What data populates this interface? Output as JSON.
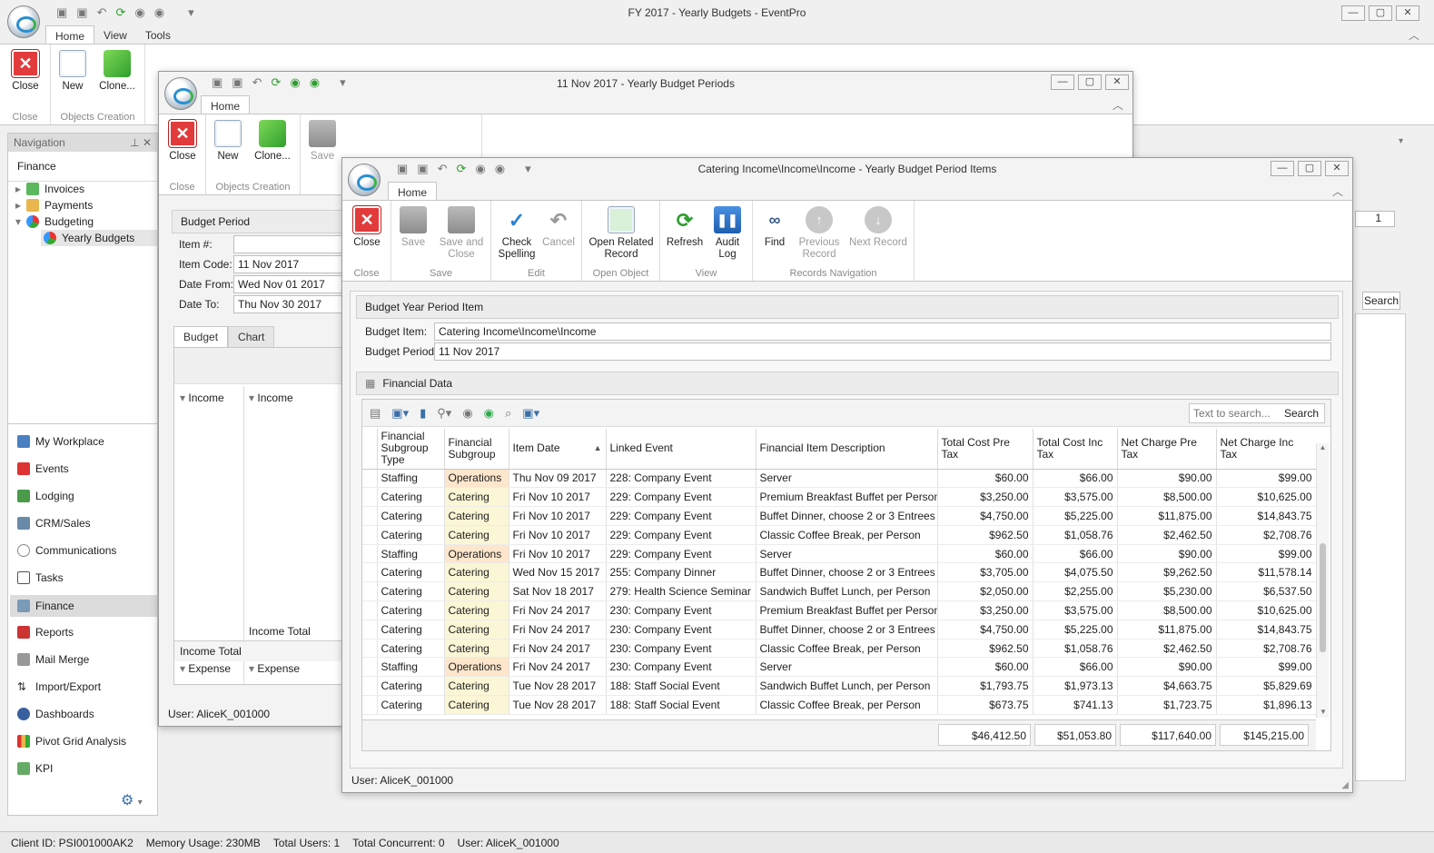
{
  "main": {
    "title": "FY 2017 - Yearly Budgets - EventPro",
    "tabs": [
      "Home",
      "View",
      "Tools"
    ],
    "close_label": "Close",
    "new_label": "New",
    "clone_label": "Clone...",
    "group_close": "Close",
    "group_objects": "Objects Creation",
    "search_label": "Search",
    "spin_value": "1"
  },
  "navigation": {
    "header": "Navigation",
    "section": "Finance",
    "tree": [
      "Invoices",
      "Payments",
      "Budgeting",
      "Yearly Budgets"
    ],
    "modules": [
      "My Workplace",
      "Events",
      "Lodging",
      "CRM/Sales",
      "Communications",
      "Tasks",
      "Finance",
      "Reports",
      "Mail Merge",
      "Import/Export",
      "Dashboards",
      "Pivot Grid Analysis",
      "KPI"
    ]
  },
  "status": {
    "client": "Client ID: PSI001000AK2",
    "memory": "Memory Usage: 230MB",
    "users": "Total Users: 1",
    "concurrent": "Total Concurrent: 0",
    "user": "User: AliceK_001000"
  },
  "periods": {
    "title": "11 Nov 2017 - Yearly Budget Periods",
    "tab": "Home",
    "buttons": {
      "close": "Close",
      "new": "New",
      "clone": "Clone...",
      "save": "Save"
    },
    "groups": {
      "close": "Close",
      "objects": "Objects Creation"
    },
    "panel_title": "Budget Period",
    "labels": {
      "item_no": "Item #:",
      "item_code": "Item Code:",
      "date_from": "Date From:",
      "date_to": "Date To:"
    },
    "values": {
      "item_no": "",
      "item_code": "11 Nov 2017",
      "date_from": "Wed Nov 01 2017",
      "date_to": "Thu Nov 30 2017"
    },
    "tabs": [
      "Budget",
      "Chart"
    ],
    "tree": {
      "income1": "Income",
      "income2": "Income",
      "income_total_inner": "Income Total",
      "income_total": "Income Total",
      "expense1": "Expense",
      "expense2": "Expense"
    },
    "user": "User: AliceK_001000"
  },
  "items": {
    "title": "Catering Income\\Income\\Income - Yearly Budget Period Items",
    "tab": "Home",
    "buttons": {
      "close": "Close",
      "save": "Save",
      "save_close": "Save and Close",
      "check": "Check Spelling",
      "cancel": "Cancel",
      "open_related": "Open Related Record",
      "refresh": "Refresh",
      "audit": "Audit Log",
      "find": "Find",
      "previous": "Previous Record",
      "next": "Next Record"
    },
    "groups": {
      "close": "Close",
      "save": "Save",
      "edit": "Edit",
      "open": "Open Object",
      "view": "View",
      "nav": "Records Navigation"
    },
    "panel_title": "Budget Year Period Item",
    "budget_item_label": "Budget Item:",
    "budget_item": "Catering Income\\Income\\Income",
    "budget_period_label": "Budget Period:",
    "budget_period": "11 Nov 2017",
    "financial_title": "Financial Data",
    "search_placeholder": "Text to search...",
    "search_button": "Search",
    "columns": [
      "Financial Subgroup Type",
      "Financial Subgroup",
      "Item Date",
      "Linked Event",
      "Financial Item Description",
      "Total Cost Pre Tax",
      "Total Cost Inc Tax",
      "Net Charge Pre Tax",
      "Net Charge Inc Tax"
    ],
    "rows": [
      [
        "Staffing",
        "Operations",
        "Thu Nov 09 2017",
        "228: Company Event",
        "Server",
        "$60.00",
        "$66.00",
        "$90.00",
        "$99.00"
      ],
      [
        "Catering",
        "Catering",
        "Fri Nov 10 2017",
        "229: Company Event",
        "Premium Breakfast Buffet per Person",
        "$3,250.00",
        "$3,575.00",
        "$8,500.00",
        "$10,625.00"
      ],
      [
        "Catering",
        "Catering",
        "Fri Nov 10 2017",
        "229: Company Event",
        "Buffet Dinner, choose 2 or 3 Entrees",
        "$4,750.00",
        "$5,225.00",
        "$11,875.00",
        "$14,843.75"
      ],
      [
        "Catering",
        "Catering",
        "Fri Nov 10 2017",
        "229: Company Event",
        "Classic Coffee Break, per Person",
        "$962.50",
        "$1,058.76",
        "$2,462.50",
        "$2,708.76"
      ],
      [
        "Staffing",
        "Operations",
        "Fri Nov 10 2017",
        "229: Company Event",
        "Server",
        "$60.00",
        "$66.00",
        "$90.00",
        "$99.00"
      ],
      [
        "Catering",
        "Catering",
        "Wed Nov 15 2017",
        "255: Company Dinner",
        "Buffet Dinner, choose 2 or 3 Entrees",
        "$3,705.00",
        "$4,075.50",
        "$9,262.50",
        "$11,578.14"
      ],
      [
        "Catering",
        "Catering",
        "Sat Nov 18 2017",
        "279: Health Science Seminar",
        "Sandwich Buffet Lunch, per Person",
        "$2,050.00",
        "$2,255.00",
        "$5,230.00",
        "$6,537.50"
      ],
      [
        "Catering",
        "Catering",
        "Fri Nov 24 2017",
        "230: Company Event",
        "Premium Breakfast Buffet per Person",
        "$3,250.00",
        "$3,575.00",
        "$8,500.00",
        "$10,625.00"
      ],
      [
        "Catering",
        "Catering",
        "Fri Nov 24 2017",
        "230: Company Event",
        "Buffet Dinner, choose 2 or 3 Entrees",
        "$4,750.00",
        "$5,225.00",
        "$11,875.00",
        "$14,843.75"
      ],
      [
        "Catering",
        "Catering",
        "Fri Nov 24 2017",
        "230: Company Event",
        "Classic Coffee Break, per Person",
        "$962.50",
        "$1,058.76",
        "$2,462.50",
        "$2,708.76"
      ],
      [
        "Staffing",
        "Operations",
        "Fri Nov 24 2017",
        "230: Company Event",
        "Server",
        "$60.00",
        "$66.00",
        "$90.00",
        "$99.00"
      ],
      [
        "Catering",
        "Catering",
        "Tue Nov 28 2017",
        "188: Staff Social Event",
        "Sandwich Buffet Lunch, per Person",
        "$1,793.75",
        "$1,973.13",
        "$4,663.75",
        "$5,829.69"
      ],
      [
        "Catering",
        "Catering",
        "Tue Nov 28 2017",
        "188: Staff Social Event",
        "Classic Coffee Break, per Person",
        "$673.75",
        "$741.13",
        "$1,723.75",
        "$1,896.13"
      ]
    ],
    "totals": [
      "$46,412.50",
      "$51,053.80",
      "$117,640.00",
      "$145,215.00"
    ],
    "user": "User: AliceK_001000"
  }
}
